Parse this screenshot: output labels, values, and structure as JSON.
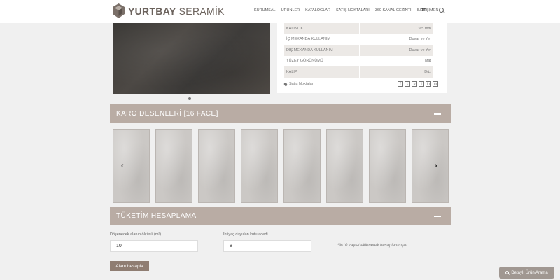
{
  "header": {
    "brand_bold": "YURTBAY",
    "brand_light": " SERAMİK",
    "nav": [
      "KURUMSAL",
      "ÜRÜNLER",
      "KATALOGLAR",
      "SATIŞ NOKTALARI",
      "360 SANAL GEZİNTİ",
      "İLETİŞİM"
    ],
    "lang_tr": "TR",
    "lang_en": "EN"
  },
  "specs": [
    {
      "key": "KALINLIK",
      "value": "9,5 mm"
    },
    {
      "key": "İÇ MEKANDA KULLANIM",
      "value": "Duvar ve Yer"
    },
    {
      "key": "DIŞ MEKANDA KULLANIM",
      "value": "Duvar ve Yer"
    },
    {
      "key": "YÜZEY GÖRÜNÜMÜ",
      "value": "Mat"
    },
    {
      "key": "KALIP",
      "value": "Düz"
    }
  ],
  "sales_points_label": "Satış Noktaları",
  "social_icons": [
    "f",
    "t",
    "p",
    "i",
    "in",
    "m"
  ],
  "tiles_section": {
    "title": "KARO DESENLERİ [16 FACE]"
  },
  "calc_section": {
    "title": "TÜKETİM HESAPLAMA"
  },
  "calc": {
    "area_label": "Döşenecek alanın ölçüsü (m²)",
    "area_value": "10",
    "boxes_label": "İhtiyaç duyulan kutu adedi",
    "boxes_value": "8",
    "note": "*%10 zayiat eklenerek hesaplanmıştır.",
    "button": "Alanı hesapla"
  },
  "detail_search": "Detaylı Ürün Arama"
}
